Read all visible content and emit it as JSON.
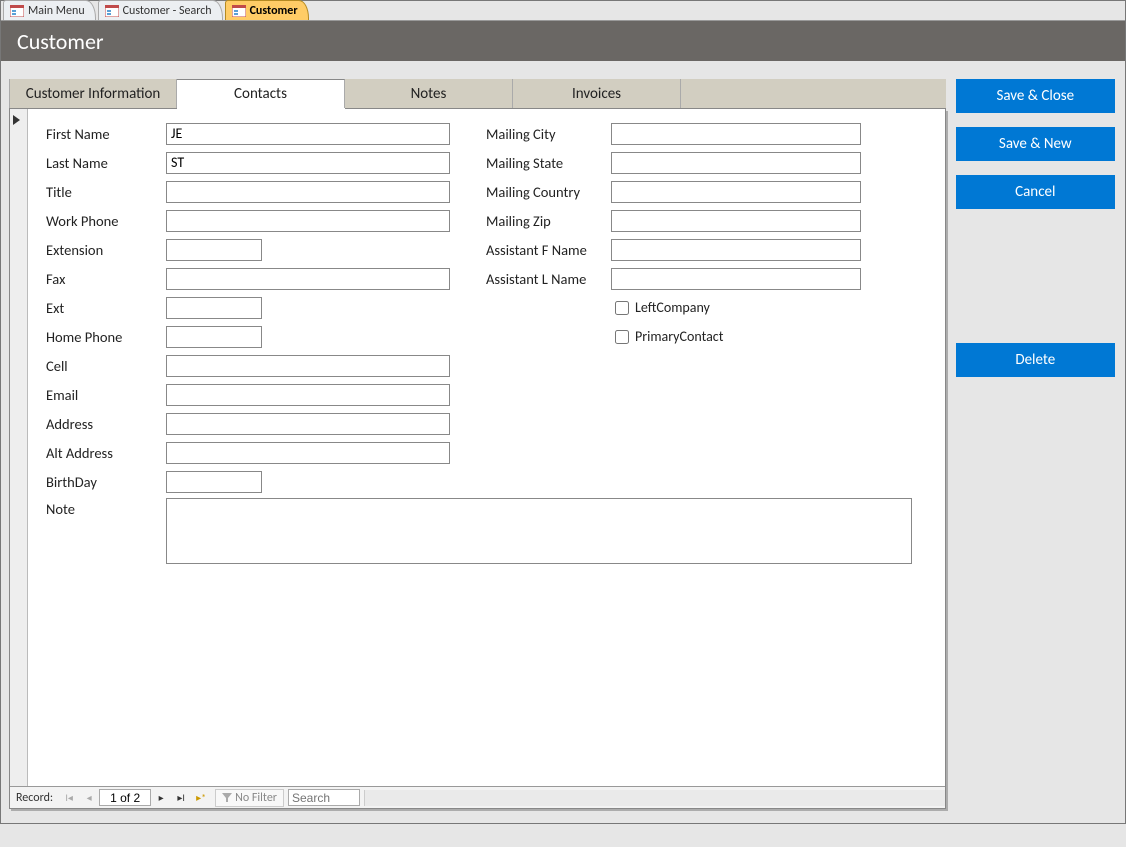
{
  "docTabs": [
    {
      "label": "Main Menu",
      "active": false
    },
    {
      "label": "Customer - Search",
      "active": false
    },
    {
      "label": "Customer",
      "active": true
    }
  ],
  "title": "Customer",
  "innerTabs": [
    {
      "label": "Customer Information",
      "active": false
    },
    {
      "label": "Contacts",
      "active": true
    },
    {
      "label": "Notes",
      "active": false
    },
    {
      "label": "Invoices",
      "active": false
    }
  ],
  "fields": {
    "first_name": {
      "label": "First Name",
      "value": "JE"
    },
    "last_name": {
      "label": "Last Name",
      "value": "ST"
    },
    "title_field": {
      "label": "Title",
      "value": ""
    },
    "work_phone": {
      "label": "Work Phone",
      "value": ""
    },
    "extension": {
      "label": "Extension",
      "value": ""
    },
    "fax": {
      "label": "Fax",
      "value": ""
    },
    "ext": {
      "label": "Ext",
      "value": ""
    },
    "home_phone": {
      "label": "Home Phone",
      "value": ""
    },
    "cell": {
      "label": "Cell",
      "value": ""
    },
    "email": {
      "label": "Email",
      "value": ""
    },
    "address": {
      "label": "Address",
      "value": ""
    },
    "alt_address": {
      "label": "Alt Address",
      "value": ""
    },
    "birthday": {
      "label": "BirthDay",
      "value": ""
    },
    "mailing_city": {
      "label": "Mailing City",
      "value": ""
    },
    "mailing_state": {
      "label": "Mailing State",
      "value": ""
    },
    "mailing_country": {
      "label": "Mailing Country",
      "value": ""
    },
    "mailing_zip": {
      "label": "Mailing Zip",
      "value": ""
    },
    "assistant_f": {
      "label": "Assistant F Name",
      "value": ""
    },
    "assistant_l": {
      "label": "Assistant L Name",
      "value": ""
    },
    "left_company": {
      "label": "LeftCompany",
      "checked": false
    },
    "primary_contact": {
      "label": "PrimaryContact",
      "checked": false
    },
    "note": {
      "label": "Note",
      "value": ""
    }
  },
  "buttons": {
    "save_close": "Save & Close",
    "save_new": "Save & New",
    "cancel": "Cancel",
    "delete": "Delete"
  },
  "recordNav": {
    "label": "Record:",
    "position": "1 of 2",
    "filter": "No Filter",
    "search_placeholder": "Search"
  }
}
